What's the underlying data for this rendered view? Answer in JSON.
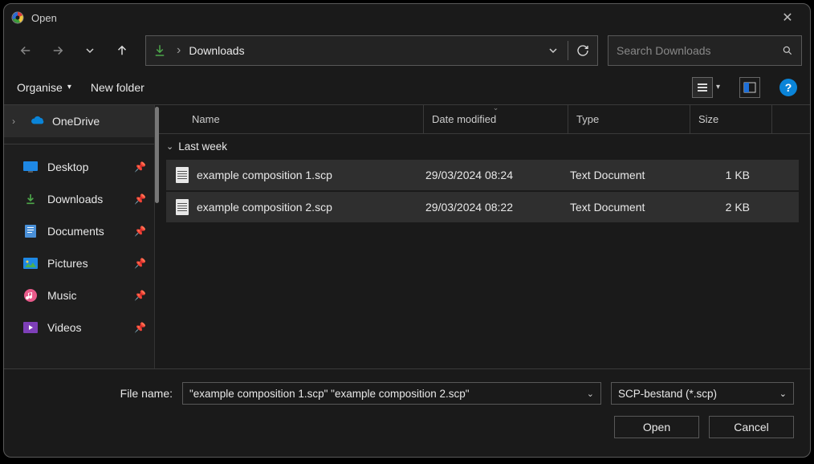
{
  "title": "Open",
  "address": {
    "crumb": "Downloads"
  },
  "search": {
    "placeholder": "Search Downloads"
  },
  "toolbar": {
    "organise": "Organise",
    "new_folder": "New folder"
  },
  "sidebar": {
    "onedrive": "OneDrive",
    "items": [
      {
        "label": "Desktop"
      },
      {
        "label": "Downloads"
      },
      {
        "label": "Documents"
      },
      {
        "label": "Pictures"
      },
      {
        "label": "Music"
      },
      {
        "label": "Videos"
      }
    ]
  },
  "columns": {
    "name": "Name",
    "date": "Date modified",
    "type": "Type",
    "size": "Size"
  },
  "group": "Last week",
  "files": [
    {
      "name": "example composition 1.scp",
      "date": "29/03/2024 08:24",
      "type": "Text Document",
      "size": "1 KB"
    },
    {
      "name": "example composition 2.scp",
      "date": "29/03/2024 08:22",
      "type": "Text Document",
      "size": "2 KB"
    }
  ],
  "footer": {
    "label": "File name:",
    "value": "\"example composition 1.scp\" \"example composition 2.scp\"",
    "filter": "SCP-bestand (*.scp)",
    "open": "Open",
    "cancel": "Cancel"
  }
}
